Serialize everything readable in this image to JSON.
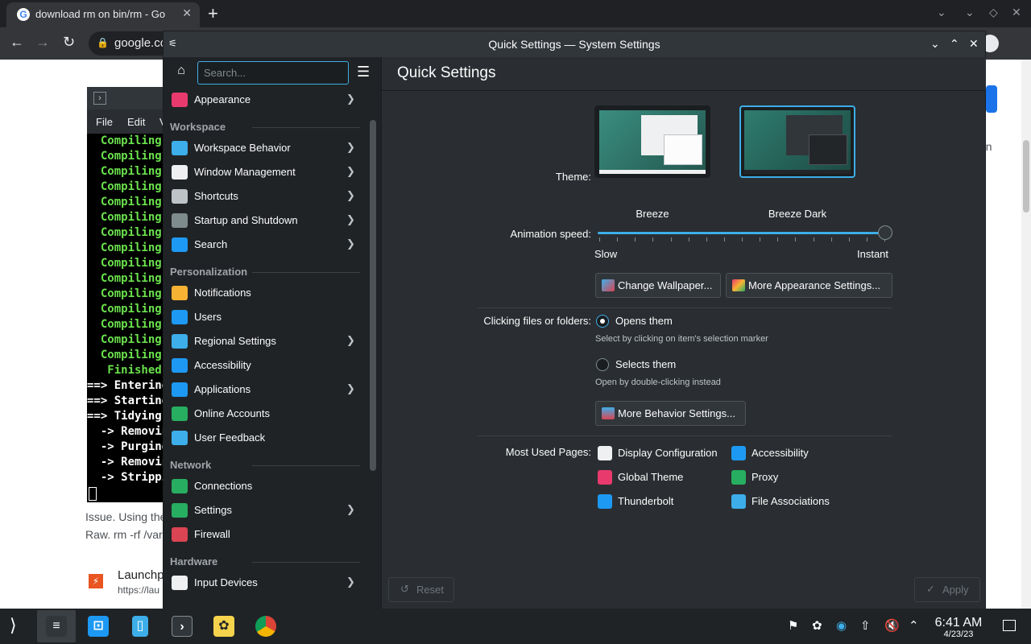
{
  "browser": {
    "tab_title": "download rm on bin/rm - Go",
    "tab_close": "✕",
    "new_tab": "+",
    "url": "google.co",
    "page_texts": [
      "Issue. Using the",
      "Raw. rm -rf /var",
      "Launchpa",
      "https://lau",
      "on"
    ]
  },
  "konsole": {
    "menu": [
      "File",
      "Edit",
      "V"
    ],
    "lines": [
      {
        "text": "  Compiling",
        "color": "g"
      },
      {
        "text": "  Compiling",
        "color": "g"
      },
      {
        "text": "  Compiling",
        "color": "g"
      },
      {
        "text": "  Compiling",
        "color": "g"
      },
      {
        "text": "  Compiling",
        "color": "g"
      },
      {
        "text": "  Compiling",
        "color": "g"
      },
      {
        "text": "  Compiling",
        "color": "g"
      },
      {
        "text": "  Compiling",
        "color": "g"
      },
      {
        "text": "  Compiling",
        "color": "g"
      },
      {
        "text": "  Compiling",
        "color": "g"
      },
      {
        "text": "  Compiling",
        "color": "g"
      },
      {
        "text": "  Compiling",
        "color": "g"
      },
      {
        "text": "  Compiling",
        "color": "g"
      },
      {
        "text": "  Compiling",
        "color": "g"
      },
      {
        "text": "  Compiling",
        "color": "g"
      },
      {
        "text": "   Finished",
        "color": "g"
      },
      {
        "text": "==> Entering",
        "color": "w"
      },
      {
        "text": "==> Starting",
        "color": "w"
      },
      {
        "text": "==> Tidying",
        "color": "w"
      },
      {
        "text": "  -> Removin",
        "color": "w"
      },
      {
        "text": "  -> Purging",
        "color": "w"
      },
      {
        "text": "  -> Removin",
        "color": "w"
      },
      {
        "text": "  -> Strippi",
        "color": "w"
      }
    ]
  },
  "window": {
    "title": "Quick Settings — System Settings"
  },
  "sidebar": {
    "search_placeholder": "Search...",
    "entries": [
      {
        "type": "item",
        "label": "Appearance",
        "chevron": true,
        "icon": "appearance-icon",
        "color": "#e93a6e"
      },
      {
        "type": "category",
        "label": "Workspace"
      },
      {
        "type": "item",
        "label": "Workspace Behavior",
        "chevron": true,
        "icon": "workspace-behavior-icon",
        "color": "#3daee9"
      },
      {
        "type": "item",
        "label": "Window Management",
        "chevron": true,
        "icon": "window-management-icon",
        "color": "#eff0f1"
      },
      {
        "type": "item",
        "label": "Shortcuts",
        "chevron": true,
        "icon": "keyboard-icon",
        "color": "#bdc3c7"
      },
      {
        "type": "item",
        "label": "Startup and Shutdown",
        "chevron": true,
        "icon": "startup-icon",
        "color": "#7f8c8d"
      },
      {
        "type": "item",
        "label": "Search",
        "chevron": true,
        "icon": "search-icon",
        "color": "#1d99f3"
      },
      {
        "type": "category",
        "label": "Personalization"
      },
      {
        "type": "item",
        "label": "Notifications",
        "chevron": false,
        "icon": "bell-icon",
        "color": "#f6b333"
      },
      {
        "type": "item",
        "label": "Users",
        "chevron": false,
        "icon": "users-icon",
        "color": "#1d99f3"
      },
      {
        "type": "item",
        "label": "Regional Settings",
        "chevron": true,
        "icon": "regional-icon",
        "color": "#3daee9"
      },
      {
        "type": "item",
        "label": "Accessibility",
        "chevron": false,
        "icon": "accessibility-icon",
        "color": "#1d99f3"
      },
      {
        "type": "item",
        "label": "Applications",
        "chevron": true,
        "icon": "applications-icon",
        "color": "#1d99f3"
      },
      {
        "type": "item",
        "label": "Online Accounts",
        "chevron": false,
        "icon": "online-accounts-icon",
        "color": "#27ae60"
      },
      {
        "type": "item",
        "label": "User Feedback",
        "chevron": false,
        "icon": "feedback-icon",
        "color": "#3daee9"
      },
      {
        "type": "category",
        "label": "Network"
      },
      {
        "type": "item",
        "label": "Connections",
        "chevron": false,
        "icon": "globe-icon",
        "color": "#27ae60"
      },
      {
        "type": "item",
        "label": "Settings",
        "chevron": true,
        "icon": "network-settings-icon",
        "color": "#27ae60"
      },
      {
        "type": "item",
        "label": "Firewall",
        "chevron": false,
        "icon": "firewall-icon",
        "color": "#da4453"
      },
      {
        "type": "category",
        "label": "Hardware"
      },
      {
        "type": "item",
        "label": "Input Devices",
        "chevron": true,
        "icon": "mouse-icon",
        "color": "#eff0f1"
      }
    ]
  },
  "main": {
    "title": "Quick Settings",
    "theme_label": "Theme:",
    "themes": [
      {
        "name": "Breeze",
        "selected": false
      },
      {
        "name": "Breeze Dark",
        "selected": true
      }
    ],
    "animation_label": "Animation speed:",
    "animation_level": 1.0,
    "slow_label": "Slow",
    "instant_label": "Instant",
    "change_wallpaper": "Change Wallpaper...",
    "more_appearance": "More Appearance Settings...",
    "clicking_label": "Clicking files or folders:",
    "opens_them": "Opens them",
    "opens_hint": "Select by clicking on item's selection marker",
    "selects_them": "Selects them",
    "selects_hint": "Open by double-clicking instead",
    "more_behavior": "More Behavior Settings...",
    "most_used_label": "Most Used Pages:",
    "most_used": [
      {
        "label": "Display Configuration",
        "icon": "display-icon",
        "color": "#eff0f1"
      },
      {
        "label": "Accessibility",
        "icon": "accessibility-icon",
        "color": "#1d99f3"
      },
      {
        "label": "Global Theme",
        "icon": "global-theme-icon",
        "color": "#e93a6e"
      },
      {
        "label": "Proxy",
        "icon": "proxy-icon",
        "color": "#27ae60"
      },
      {
        "label": "Thunderbolt",
        "icon": "thunderbolt-icon",
        "color": "#1d99f3"
      },
      {
        "label": "File Associations",
        "icon": "file-associations-icon",
        "color": "#3daee9"
      }
    ],
    "reset": "Reset",
    "apply": "Apply"
  },
  "taskbar": {
    "time": "6:41 AM",
    "date": "4/23/23"
  },
  "colors": {
    "accent": "#3daee9",
    "window_bg": "#2a2e32",
    "sidebar_bg": "#202326"
  }
}
